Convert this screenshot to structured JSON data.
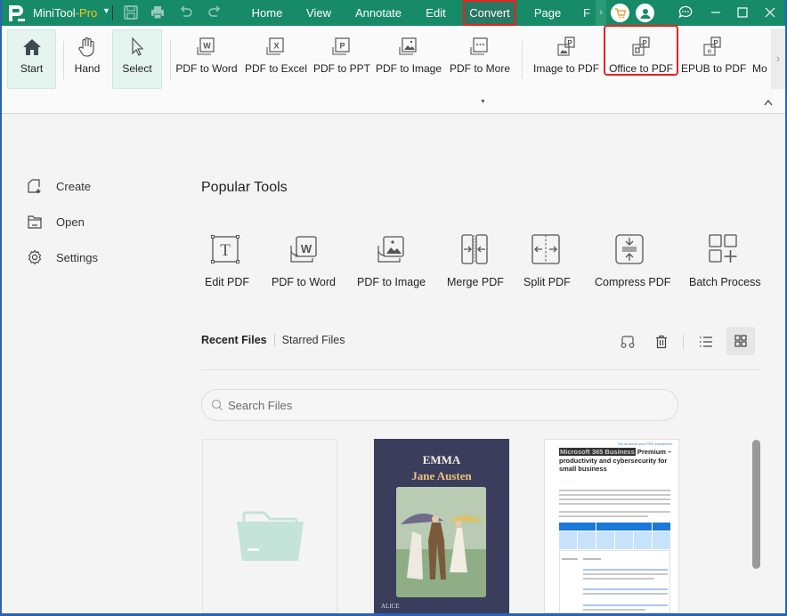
{
  "titlebar": {
    "app_name": "MiniTool",
    "app_suffix": "-Pro",
    "menu_tabs": [
      {
        "label": "Home"
      },
      {
        "label": "View"
      },
      {
        "label": "Annotate"
      },
      {
        "label": "Edit"
      },
      {
        "label": "Convert",
        "active": true
      },
      {
        "label": "Page"
      },
      {
        "label": "F"
      }
    ],
    "icons": [
      "save-icon",
      "print-icon",
      "undo-icon",
      "redo-icon",
      "cart-icon",
      "account-icon",
      "feedback-icon",
      "minimize-icon",
      "maximize-icon",
      "close-icon"
    ]
  },
  "ribbon": {
    "buttons": [
      {
        "label": "Start",
        "icon": "home-icon",
        "selected": true
      },
      {
        "label": "Hand",
        "icon": "hand-icon"
      },
      {
        "label": "Select",
        "icon": "cursor-icon",
        "selected": true
      },
      {
        "label": "PDF to Word",
        "icon": "pdf-to-word-icon"
      },
      {
        "label": "PDF to Excel",
        "icon": "pdf-to-excel-icon"
      },
      {
        "label": "PDF to PPT",
        "icon": "pdf-to-ppt-icon"
      },
      {
        "label": "PDF to Image",
        "icon": "pdf-to-image-icon"
      },
      {
        "label": "PDF to More",
        "icon": "pdf-to-more-icon",
        "has_dropdown": true
      },
      {
        "label": "Image to PDF",
        "icon": "image-to-pdf-icon"
      },
      {
        "label": "Office to PDF",
        "icon": "office-to-pdf-icon",
        "highlighted": true
      },
      {
        "label": "EPUB to PDF",
        "icon": "epub-to-pdf-icon"
      },
      {
        "label": "Mo",
        "icon": "more-icon"
      }
    ]
  },
  "sidebar": {
    "items": [
      {
        "label": "Create",
        "icon": "create-icon"
      },
      {
        "label": "Open",
        "icon": "open-folder-icon"
      },
      {
        "label": "Settings",
        "icon": "gear-icon"
      }
    ]
  },
  "main": {
    "popular_tools_title": "Popular Tools",
    "tools": [
      {
        "label": "Edit PDF",
        "icon": "edit-pdf-icon"
      },
      {
        "label": "PDF to Word",
        "icon": "pdf-to-word-icon"
      },
      {
        "label": "PDF to Image",
        "icon": "pdf-to-image-icon"
      },
      {
        "label": "Merge PDF",
        "icon": "merge-pdf-icon"
      },
      {
        "label": "Split PDF",
        "icon": "split-pdf-icon"
      },
      {
        "label": "Compress PDF",
        "icon": "compress-pdf-icon"
      },
      {
        "label": "Batch Process",
        "icon": "batch-process-icon"
      }
    ],
    "file_tabs": {
      "recent": "Recent Files",
      "starred": "Starred Files"
    },
    "file_tools": [
      "glasses-icon",
      "trash-icon",
      "list-view-icon",
      "grid-view-icon"
    ],
    "search": {
      "placeholder": "Search Files",
      "value": ""
    },
    "files": [
      {
        "type": "open-folder"
      },
      {
        "type": "book",
        "title": "EMMA",
        "author": "Jane Austen",
        "publisher": "ALICE"
      },
      {
        "type": "document",
        "link": "Tell us about your PDF experience.",
        "highlight": "Microsoft 365 Business",
        "heading": "Premium – productivity and cybersecurity for small business"
      }
    ]
  },
  "colors": {
    "titlebar": "#178a67",
    "highlight_outline": "#e8231b",
    "pro_accent": "#f5c518",
    "selected_bg": "#e4f4ee",
    "folder_icon": "#c4e3d9"
  }
}
